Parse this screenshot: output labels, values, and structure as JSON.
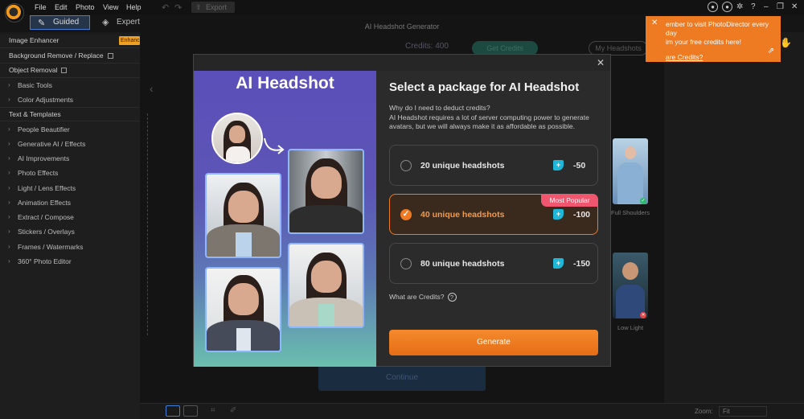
{
  "menubar": {
    "menus": [
      "File",
      "Edit",
      "Photo",
      "View",
      "Help"
    ],
    "export_label": "Export",
    "help_label": "?"
  },
  "modes": {
    "guided": "Guided",
    "expert": "Expert"
  },
  "sidebar": {
    "image_enhancer": "Image Enhancer",
    "enhance_badge": "Enhance",
    "background_remove": "Background Remove / Replace",
    "object_removal": "Object Removal",
    "groups": [
      {
        "label": "Basic Tools"
      },
      {
        "label": "Color Adjustments"
      }
    ],
    "text_templates": "Text & Templates",
    "groups2": [
      {
        "label": "People Beautifier"
      },
      {
        "label": "Generative AI / Effects"
      },
      {
        "label": "AI Improvements"
      },
      {
        "label": "Photo Effects"
      },
      {
        "label": "Light / Lens Effects"
      },
      {
        "label": "Animation Effects"
      },
      {
        "label": "Extract / Compose"
      },
      {
        "label": "Stickers / Overlays"
      },
      {
        "label": "Frames / Watermarks"
      },
      {
        "label": "360° Photo Editor"
      }
    ]
  },
  "background_window": {
    "title": "AI Headshot Generator",
    "credits": "Credits: 400",
    "get_credits": "Get Credits",
    "my_headshots": "My Headshots",
    "continue": "Continue",
    "thumb_full_shoulders": "Full Shoulders",
    "thumb_low_light": "Low Light"
  },
  "tooltip": {
    "text": "ember to visit PhotoDirector every day\nim your free credits here!",
    "link": "are Credits?"
  },
  "bottombar": {
    "zoom_label": "Zoom:",
    "zoom_value": "Fit"
  },
  "modal": {
    "headline": "AI Headshot",
    "title": "Select a package for AI Headshot",
    "description": "Why do I need to deduct credits?\nAI Headshot requires a lot of server computing power to generate avatars, but we will always make it as affordable as possible.",
    "packages": [
      {
        "label": "20 unique headshots",
        "cost": "-50",
        "selected": false
      },
      {
        "label": "40 unique headshots",
        "cost": "-100",
        "selected": true,
        "badge": "Most Popular"
      },
      {
        "label": "80 unique headshots",
        "cost": "-150",
        "selected": false
      }
    ],
    "what_are_credits": "What are Credits?",
    "help_glyph": "?",
    "generate": "Generate"
  },
  "colors": {
    "accent": "#f07a22",
    "guided_border": "#3d7fd8",
    "popular": "#f1566f",
    "credit_icon": "#1fb7d7"
  }
}
